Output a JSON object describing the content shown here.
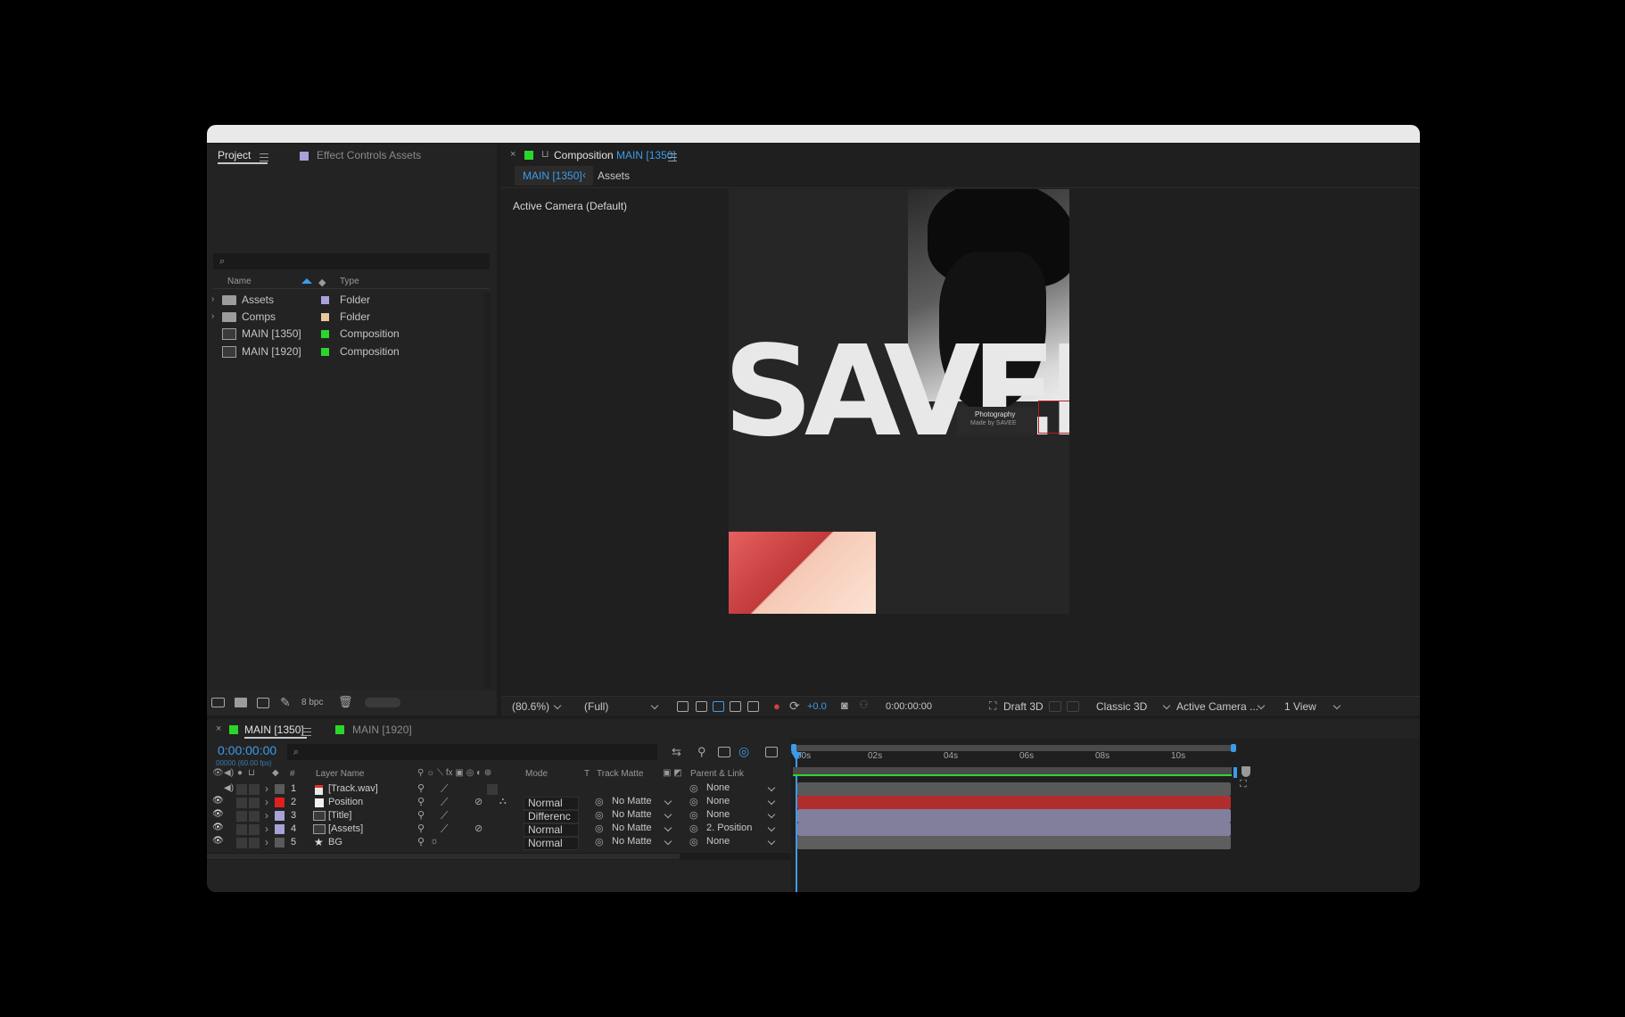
{
  "project_panel": {
    "tab_project": "Project",
    "tab_effect_controls": "Effect Controls Assets",
    "search_placeholder": "",
    "col_name": "Name",
    "col_type": "Type",
    "items": [
      {
        "name": "Assets",
        "type": "Folder",
        "label_color": "#a7a2d8",
        "kind": "folder"
      },
      {
        "name": "Comps",
        "type": "Folder",
        "label_color": "#e8c79a",
        "kind": "folder"
      },
      {
        "name": "MAIN [1350]",
        "type": "Composition",
        "label_color": "#2bd62b",
        "kind": "comp"
      },
      {
        "name": "MAIN [1920]",
        "type": "Composition",
        "label_color": "#2bd62b",
        "kind": "comp"
      }
    ],
    "bpc": "8 bpc"
  },
  "composition_panel": {
    "title_prefix": "Composition",
    "title_name": "MAIN [1350]",
    "breadcrumb_active": "MAIN [1350]",
    "breadcrumb_next": "Assets",
    "camera_label": "Active Camera (Default)",
    "artwork_title": "SAVEE",
    "artwork_caption_1": "Photography",
    "artwork_caption_2": "Made by SAVEE",
    "toolbar": {
      "zoom": "(80.6%)",
      "resolution": "(Full)",
      "exposure": "+0.0",
      "timecode": "0:00:00:00",
      "draft3d": "Draft 3D",
      "renderer": "Classic 3D",
      "camera": "Active Camera ...",
      "views": "1 View"
    }
  },
  "timeline": {
    "tab_active": "MAIN [1350]",
    "tab_other": "MAIN [1920]",
    "timecode": "0:00:00:00",
    "frame_info": "00000 (60.00 fps)",
    "ruler": [
      "00s",
      "02s",
      "04s",
      "06s",
      "08s",
      "10s"
    ],
    "headers": {
      "num": "#",
      "layer_name": "Layer Name",
      "mode": "Mode",
      "t": "T",
      "track_matte": "Track Matte",
      "parent": "Parent & Link"
    },
    "layers": [
      {
        "num": "1",
        "name": "[Track.wav]",
        "mode": "",
        "matte": "",
        "parent": "None",
        "label_color": "#5a5a5a",
        "bar_color": "#595959"
      },
      {
        "num": "2",
        "name": "Position",
        "mode": "Normal",
        "matte": "No Matte",
        "parent": "None",
        "label_color": "#e02020",
        "bar_color": "#b12d2d"
      },
      {
        "num": "3",
        "name": "[Title]",
        "mode": "Differenc",
        "matte": "No Matte",
        "parent": "None",
        "label_color": "#a7a2d8",
        "bar_color": "#817f9c"
      },
      {
        "num": "4",
        "name": "[Assets]",
        "mode": "Normal",
        "matte": "No Matte",
        "parent": "2. Position",
        "label_color": "#a7a2d8",
        "bar_color": "#817f9c"
      },
      {
        "num": "5",
        "name": "BG",
        "mode": "Normal",
        "matte": "No Matte",
        "parent": "None",
        "label_color": "#5a5a5a",
        "bar_color": "#5e5e5e"
      }
    ]
  }
}
